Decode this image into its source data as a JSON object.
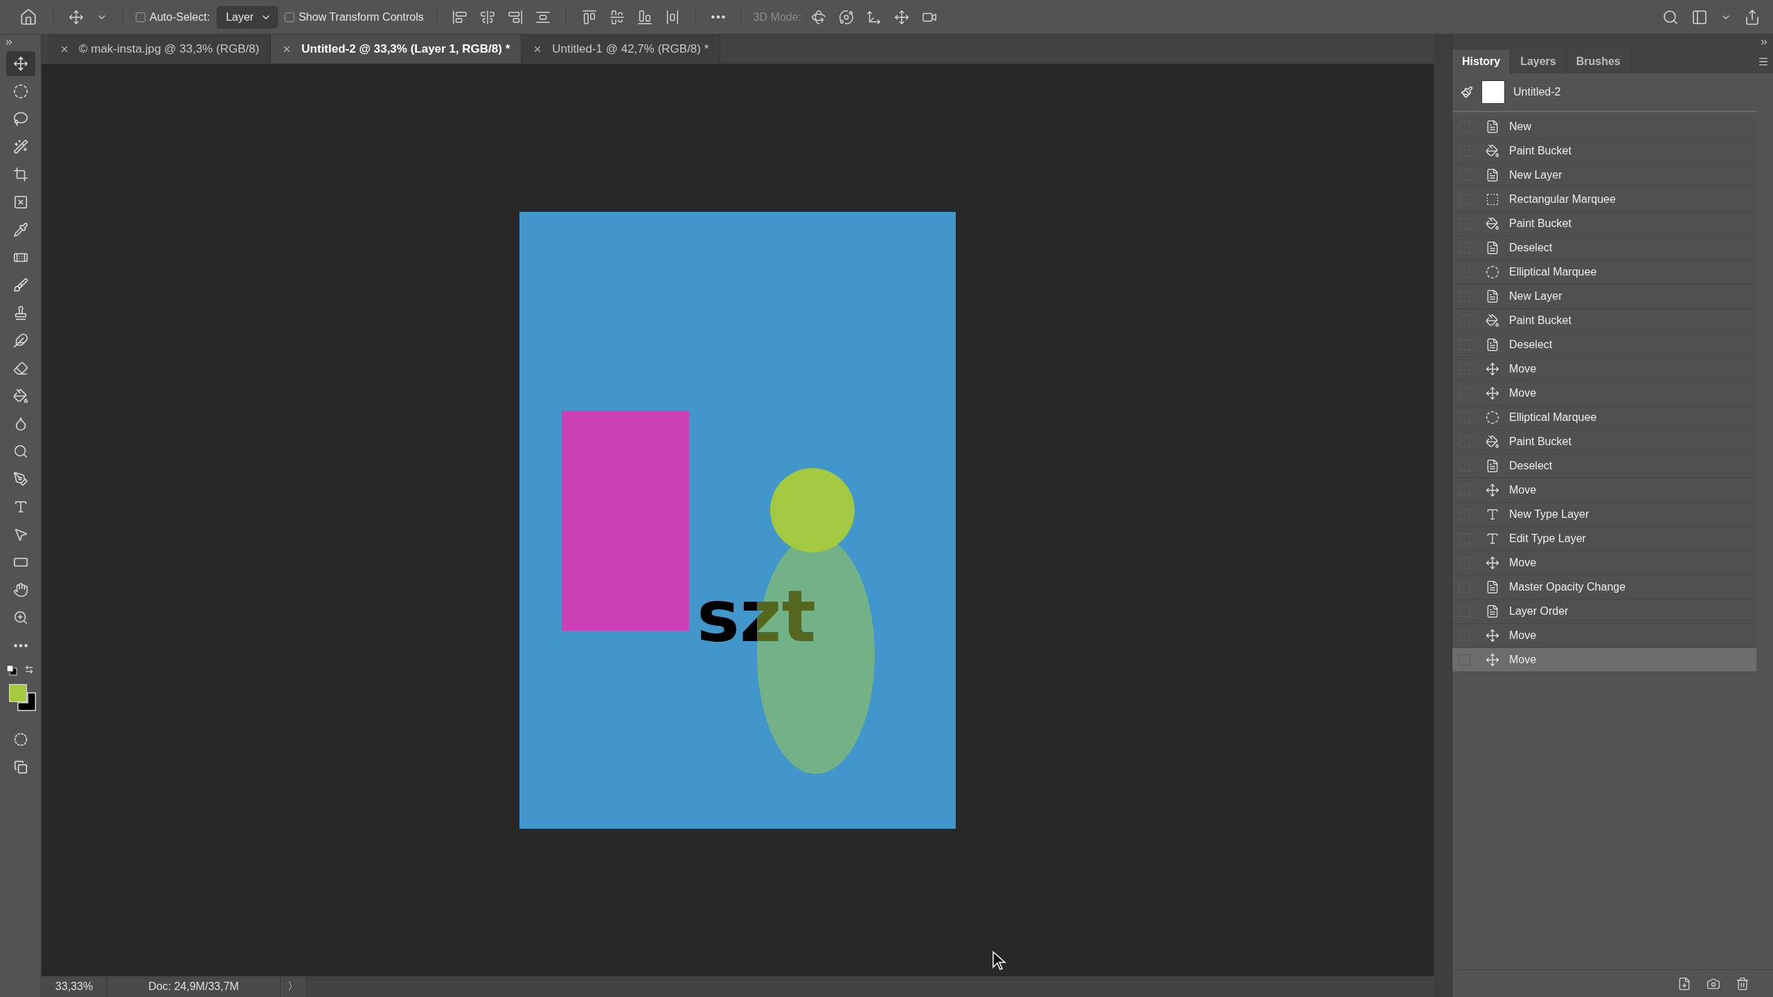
{
  "options_bar": {
    "auto_select": {
      "label": "Auto-Select:",
      "checked": false
    },
    "target": "Layer",
    "transform": {
      "label": "Show Transform Controls",
      "checked": false
    },
    "mode_label": "3D Mode:"
  },
  "tabs": [
    {
      "label": "© mak-insta.jpg @ 33,3% (RGB/8)",
      "selected": false
    },
    {
      "label": "Untitled-2 @ 33,3% (Layer 1, RGB/8) *",
      "selected": true
    },
    {
      "label": "Untitled-1 @ 42,7% (RGB/8) *",
      "selected": false
    }
  ],
  "tools": [
    {
      "kind": "move",
      "selected": true
    },
    {
      "kind": "marquee",
      "selected": false
    },
    {
      "kind": "lasso",
      "selected": false
    },
    {
      "kind": "quick-select",
      "selected": false
    },
    {
      "kind": "crop",
      "selected": false
    },
    {
      "kind": "frame",
      "selected": false
    },
    {
      "kind": "eyedropper",
      "selected": false
    },
    {
      "kind": "healing",
      "selected": false
    },
    {
      "kind": "brush",
      "selected": false
    },
    {
      "kind": "stamp",
      "selected": false
    },
    {
      "kind": "history-brush",
      "selected": false
    },
    {
      "kind": "eraser",
      "selected": false
    },
    {
      "kind": "bucket",
      "selected": false
    },
    {
      "kind": "blur",
      "selected": false
    },
    {
      "kind": "dodge",
      "selected": false
    },
    {
      "kind": "pen",
      "selected": false
    },
    {
      "kind": "type",
      "selected": false
    },
    {
      "kind": "select",
      "selected": false
    },
    {
      "kind": "shape",
      "selected": false
    },
    {
      "kind": "hand",
      "selected": false
    },
    {
      "kind": "zoom",
      "selected": false
    },
    {
      "kind": "more",
      "selected": false
    }
  ],
  "swatches": [
    {
      "kind": "foreground",
      "color": "#a4c93f"
    },
    {
      "kind": "background",
      "color": "#000000"
    }
  ],
  "document": {
    "text": "szt"
  },
  "status_bar": {
    "zoom": "33,33%",
    "doc": "Doc: 24,9M/33,7M",
    "arrow": "〉"
  },
  "panel": {
    "tabs": [
      {
        "label": "History",
        "selected": true
      },
      {
        "label": "Layers",
        "selected": false
      },
      {
        "label": "Brushes",
        "selected": false
      }
    ],
    "snapshot": "Untitled-2",
    "history": [
      {
        "label": "New",
        "kind": "document",
        "selected": false
      },
      {
        "label": "Paint Bucket",
        "kind": "bucket",
        "selected": false
      },
      {
        "label": "New Layer",
        "kind": "document",
        "selected": false
      },
      {
        "label": "Rectangular Marquee",
        "kind": "rect-marquee",
        "selected": false
      },
      {
        "label": "Paint Bucket",
        "kind": "bucket",
        "selected": false
      },
      {
        "label": "Deselect",
        "kind": "document",
        "selected": false
      },
      {
        "label": "Elliptical Marquee",
        "kind": "ellipse-marquee",
        "selected": false
      },
      {
        "label": "New Layer",
        "kind": "document",
        "selected": false
      },
      {
        "label": "Paint Bucket",
        "kind": "bucket",
        "selected": false
      },
      {
        "label": "Deselect",
        "kind": "document",
        "selected": false
      },
      {
        "label": "Move",
        "kind": "move",
        "selected": false
      },
      {
        "label": "Move",
        "kind": "move",
        "selected": false
      },
      {
        "label": "Elliptical Marquee",
        "kind": "ellipse-marquee",
        "selected": false
      },
      {
        "label": "Paint Bucket",
        "kind": "bucket",
        "selected": false
      },
      {
        "label": "Deselect",
        "kind": "document",
        "selected": false
      },
      {
        "label": "Move",
        "kind": "move",
        "selected": false
      },
      {
        "label": "New Type Layer",
        "kind": "type",
        "selected": false
      },
      {
        "label": "Edit Type Layer",
        "kind": "type",
        "selected": false
      },
      {
        "label": "Move",
        "kind": "move",
        "selected": false
      },
      {
        "label": "Master Opacity Change",
        "kind": "document",
        "selected": false
      },
      {
        "label": "Layer Order",
        "kind": "document",
        "selected": false
      },
      {
        "label": "Move",
        "kind": "move",
        "selected": false
      },
      {
        "label": "Move",
        "kind": "move",
        "selected": true
      }
    ]
  }
}
